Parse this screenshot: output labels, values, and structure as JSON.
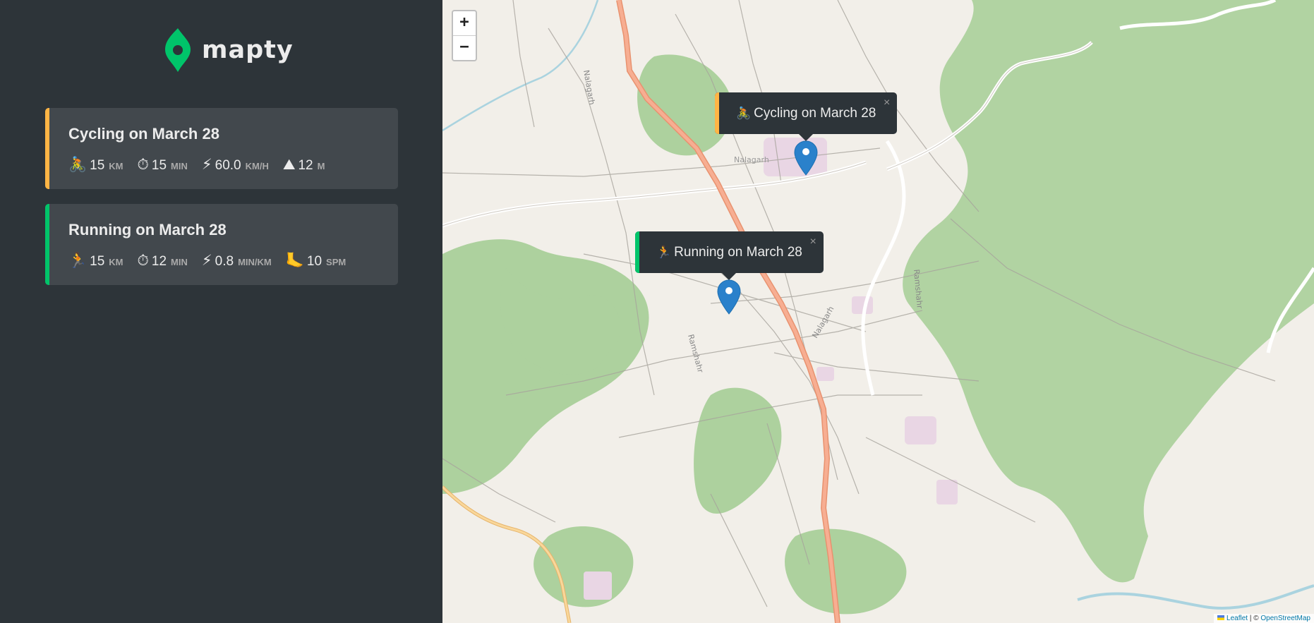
{
  "app": {
    "logo_text": "mapty",
    "logo_color": "#00c46a"
  },
  "workouts": [
    {
      "type": "cycling",
      "title": "Cycling on March 28",
      "accent": "#ffb545",
      "details": [
        {
          "icon": "bicycle-icon",
          "glyph": "🚴",
          "value": "15",
          "unit": "km"
        },
        {
          "icon": "stopwatch-icon",
          "glyph": "⏱",
          "value": "15",
          "unit": "min"
        },
        {
          "icon": "lightning-icon",
          "glyph": "⚡",
          "value": "60.0",
          "unit": "km/h"
        },
        {
          "icon": "mountain-icon",
          "glyph": "⛰",
          "value": "12",
          "unit": "m"
        }
      ]
    },
    {
      "type": "running",
      "title": "Running on March 28",
      "accent": "#00c46a",
      "details": [
        {
          "icon": "runner-icon",
          "glyph": "🏃",
          "value": "15",
          "unit": "km"
        },
        {
          "icon": "stopwatch-icon",
          "glyph": "⏱",
          "value": "12",
          "unit": "min"
        },
        {
          "icon": "lightning-icon",
          "glyph": "⚡",
          "value": "0.8",
          "unit": "min/km"
        },
        {
          "icon": "footprint-icon",
          "glyph": "🦶",
          "value": "10",
          "unit": "spm"
        }
      ]
    }
  ],
  "map": {
    "zoom_in": "+",
    "zoom_out": "−",
    "popups": [
      {
        "glyph": "🚴",
        "label": "Cycling on March 28",
        "close": "×"
      },
      {
        "glyph": "🏃",
        "label": "Running on March 28",
        "close": "×"
      }
    ],
    "labels": {
      "nalagarh_top": "Nalagarh",
      "nalagarh_town": "Nalagarh",
      "nalagarh_right": "Nalagarh",
      "ramshahr": "Ramshahr",
      "ramshahr_right": "Ramshahr"
    },
    "attribution": {
      "leaflet": "Leaflet",
      "separator": " | © ",
      "osm": "OpenStreetMap"
    },
    "colors": {
      "land": "#f2efe9",
      "forest": "#add19e",
      "main_road": "#f2a88a",
      "secondary_road": "#f7c98b",
      "water": "#aad3df",
      "marker": "#2a81cb"
    }
  }
}
